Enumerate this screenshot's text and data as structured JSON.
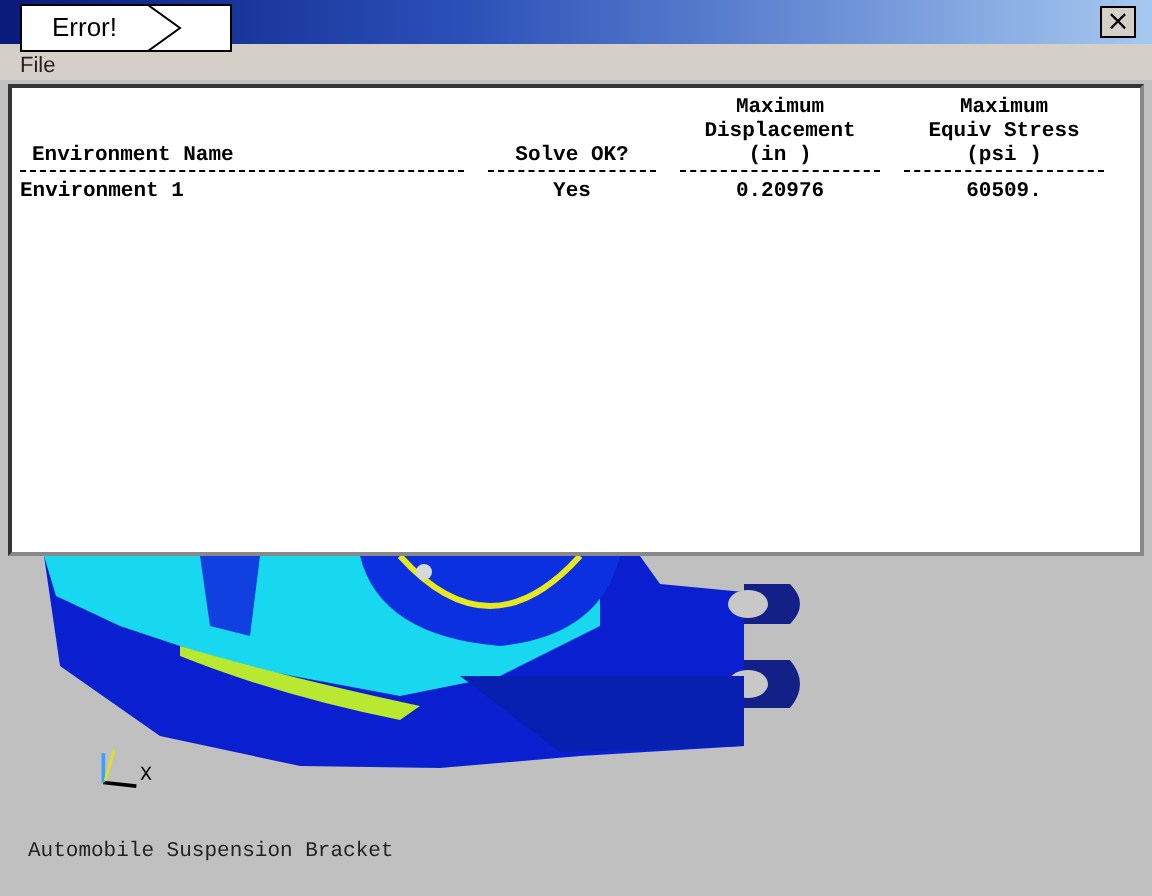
{
  "window": {
    "close": "×"
  },
  "callout": {
    "text": "Error!"
  },
  "menu": [
    "File"
  ],
  "table": {
    "columns": [
      {
        "lines": [
          "Environment Name"
        ]
      },
      {
        "lines": [
          "Solve OK?"
        ]
      },
      {
        "lines": [
          "Maximum",
          "Displacement",
          "(in        )"
        ]
      },
      {
        "lines": [
          "Maximum",
          "Equiv Stress",
          "(psi       )"
        ]
      }
    ],
    "rows": [
      [
        "Environment 1",
        "Yes",
        "0.20976",
        "60509."
      ]
    ]
  },
  "viewer": {
    "axis_label": "X",
    "caption": "Automobile Suspension Bracket"
  }
}
